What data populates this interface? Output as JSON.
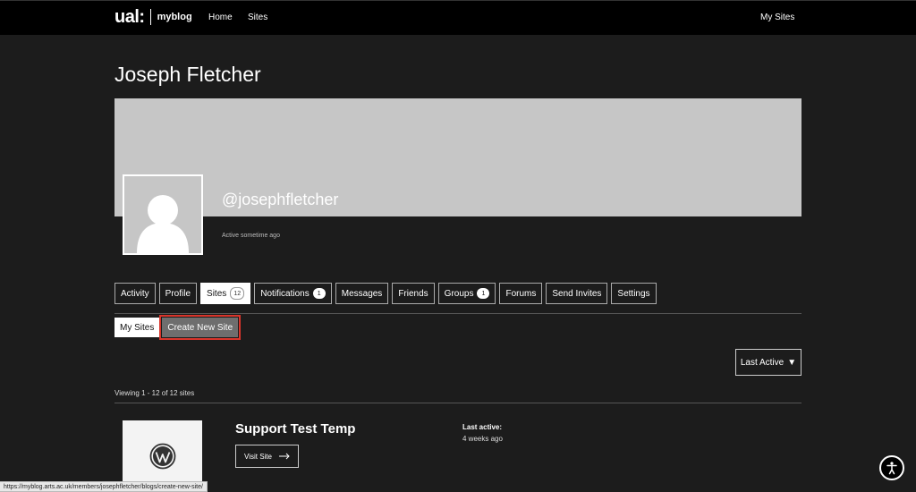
{
  "topbar": {
    "logo_main": "ual:",
    "logo_sub": "myblog",
    "nav": [
      "Home",
      "Sites"
    ],
    "my_sites": "My Sites"
  },
  "profile": {
    "name": "Joseph Fletcher",
    "handle": "@josephfletcher",
    "activity": "Active sometime ago"
  },
  "tabs": [
    {
      "label": "Activity"
    },
    {
      "label": "Profile"
    },
    {
      "label": "Sites",
      "count": "12",
      "current": true
    },
    {
      "label": "Notifications",
      "count": "1"
    },
    {
      "label": "Messages"
    },
    {
      "label": "Friends"
    },
    {
      "label": "Groups",
      "count": "1"
    },
    {
      "label": "Forums"
    },
    {
      "label": "Send Invites"
    },
    {
      "label": "Settings"
    }
  ],
  "subnav": {
    "my_sites": "My Sites",
    "create_new": "Create New Site"
  },
  "sort": {
    "label": "Last Active",
    "arrow": "▼"
  },
  "listing": {
    "viewing": "Viewing 1 - 12 of 12 sites"
  },
  "site": {
    "name": "Support Test Temp",
    "visit": "Visit Site",
    "last_active_label": "Last active:",
    "last_active_value": "4 weeks ago"
  },
  "statusbar": {
    "url": "https://myblog.arts.ac.uk/members/josephfletcher/blogs/create-new-site/"
  },
  "icons": {
    "avatar": "default-avatar-icon",
    "wordpress": "wordpress-icon",
    "arrow": "arrow-right-icon",
    "accessibility": "accessibility-icon"
  }
}
